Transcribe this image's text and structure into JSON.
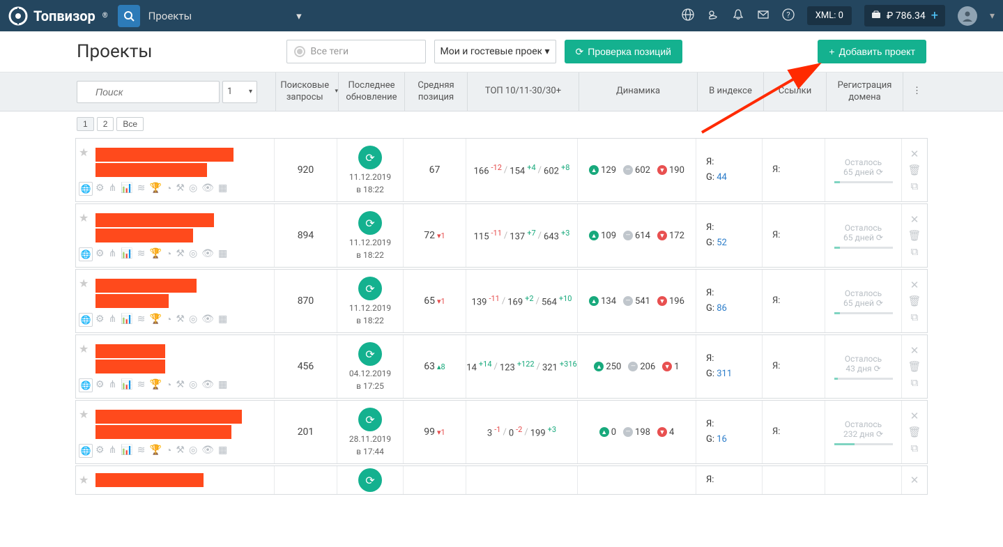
{
  "topbar": {
    "brand": "Топвизор",
    "project_selector": "Проекты",
    "xml_label": "XML: 0",
    "balance": "₽ 786.34"
  },
  "pagehead": {
    "title": "Проекты",
    "tags_placeholder": "Все теги",
    "visibility_label": "Мои и гостевые проекты",
    "check_btn": "Проверка позиций",
    "add_btn": "Добавить проект"
  },
  "columns": {
    "queries": "Поисковые запросы",
    "update": "Последнее обновление",
    "avgpos": "Средняя позиция",
    "top": "ТОП 10/11-30/30+",
    "dynamics": "Динамика",
    "index": "В индексе",
    "links": "Ссылки",
    "reg": "Регистрация домена"
  },
  "search": {
    "placeholder": "Поиск",
    "num": "1"
  },
  "pagebtns": {
    "p1": "1",
    "p2": "2",
    "all": "Все"
  },
  "labels": {
    "ya": "Я:",
    "g": "G:",
    "remaining": "Осталось"
  },
  "rows": [
    {
      "queries": "920",
      "date": "11.12.2019",
      "time": "в 18:22",
      "avgpos": "67",
      "avgpos_delta": "",
      "avgpos_dir": "",
      "top10": "166",
      "top10_d": "-12",
      "top30": "154",
      "top30_d": "+4",
      "top30p": "602",
      "top30p_d": "+8",
      "dyn_up": "129",
      "dyn_neutral": "602",
      "dyn_down": "190",
      "g_index": "44",
      "reg_days": "65 дней",
      "reg_pct": 10,
      "name_widths": [
        198,
        160
      ]
    },
    {
      "queries": "894",
      "date": "11.12.2019",
      "time": "в 18:22",
      "avgpos": "72",
      "avgpos_delta": "1",
      "avgpos_dir": "down",
      "top10": "115",
      "top10_d": "-11",
      "top30": "137",
      "top30_d": "+7",
      "top30p": "643",
      "top30p_d": "+3",
      "dyn_up": "109",
      "dyn_neutral": "614",
      "dyn_down": "172",
      "g_index": "52",
      "reg_days": "65 дней",
      "reg_pct": 10,
      "name_widths": [
        170,
        140
      ]
    },
    {
      "queries": "870",
      "date": "11.12.2019",
      "time": "в 18:22",
      "avgpos": "65",
      "avgpos_delta": "1",
      "avgpos_dir": "down",
      "top10": "139",
      "top10_d": "-11",
      "top30": "169",
      "top30_d": "+2",
      "top30p": "564",
      "top30p_d": "+10",
      "dyn_up": "134",
      "dyn_neutral": "541",
      "dyn_down": "196",
      "g_index": "86",
      "reg_days": "65 дней",
      "reg_pct": 10,
      "name_widths": [
        145,
        105
      ]
    },
    {
      "queries": "456",
      "date": "04.12.2019",
      "time": "в 17:25",
      "avgpos": "63",
      "avgpos_delta": "8",
      "avgpos_dir": "up",
      "top10": "14",
      "top10_d": "+14",
      "top30": "123",
      "top30_d": "+122",
      "top30p": "321",
      "top30p_d": "+316",
      "dyn_up": "250",
      "dyn_neutral": "206",
      "dyn_down": "1",
      "g_index": "311",
      "reg_days": "43 дня",
      "reg_pct": 7,
      "name_widths": [
        100,
        100
      ]
    },
    {
      "queries": "201",
      "date": "28.11.2019",
      "time": "в 17:44",
      "avgpos": "99",
      "avgpos_delta": "1",
      "avgpos_dir": "down",
      "top10": "3",
      "top10_d": "-1",
      "top30": "0",
      "top30_d": "-2",
      "top30p": "199",
      "top30p_d": "+3",
      "dyn_up": "0",
      "dyn_neutral": "198",
      "dyn_down": "4",
      "g_index": "16",
      "reg_days": "232 дня",
      "reg_pct": 35,
      "name_widths": [
        210,
        195
      ]
    }
  ]
}
